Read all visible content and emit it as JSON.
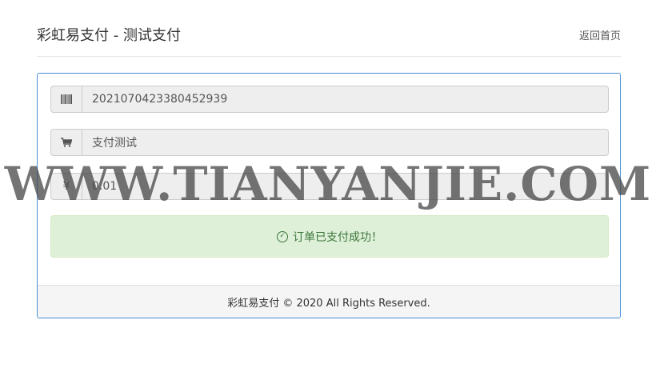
{
  "header": {
    "title": "彩虹易支付 - 测试支付",
    "home_link": "返回首页"
  },
  "order": {
    "order_no": "2021070423380452939",
    "product_name": "支付测试",
    "amount": "0.01",
    "icons": {
      "order_no": "barcode-icon",
      "product_name": "cart-icon",
      "amount": "yen-icon"
    }
  },
  "alert": {
    "message": "订单已支付成功！",
    "icon": "check-circle-icon"
  },
  "footer": {
    "copyright": "彩虹易支付 © 2020 All Rights Reserved."
  },
  "watermark": "WWW.TIANYANJIE.COM",
  "colors": {
    "panel_border": "#4a90d9",
    "alert_bg": "#dff0d8",
    "alert_text": "#3c763d"
  }
}
